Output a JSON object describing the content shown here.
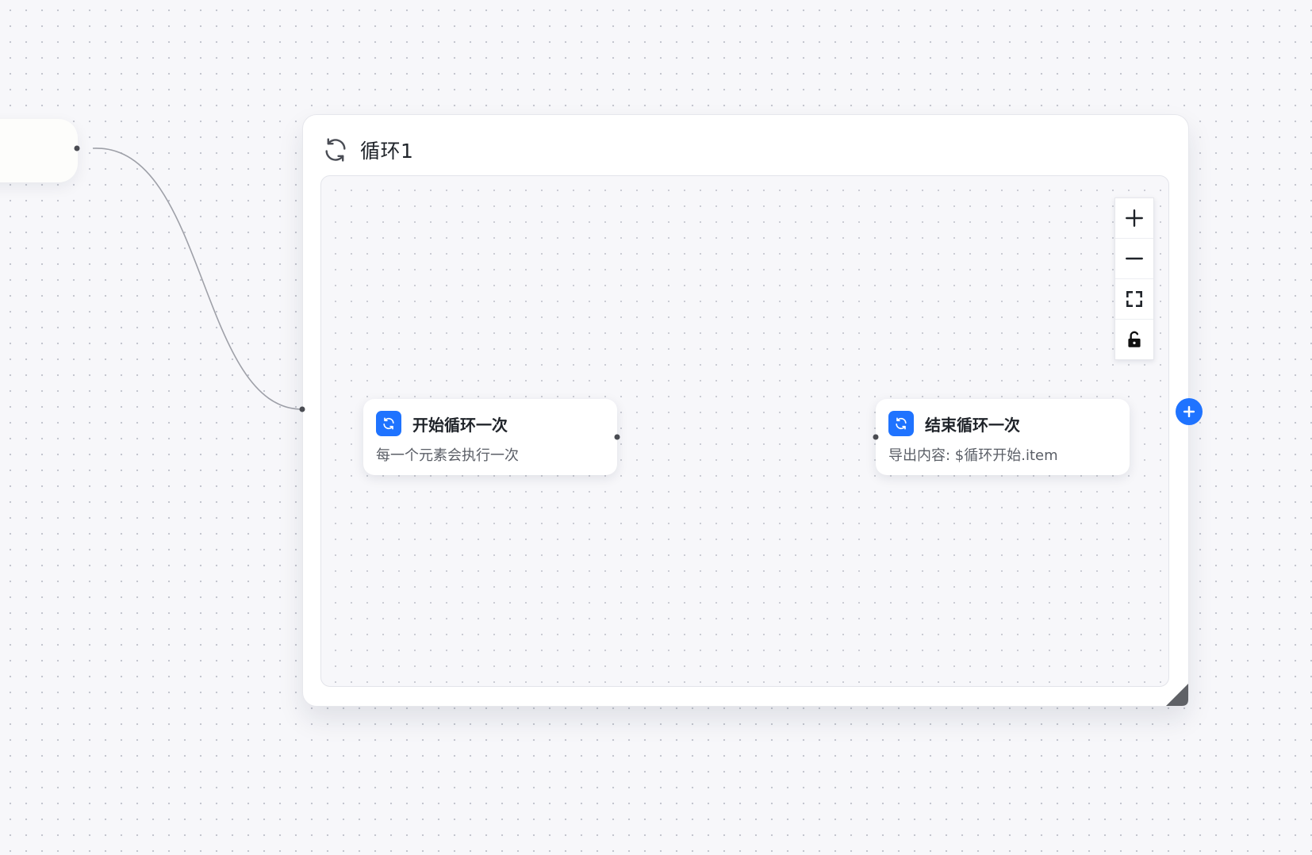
{
  "loop_group": {
    "title": "循环1",
    "icon": "refresh-icon"
  },
  "nodes": {
    "start": {
      "title": "开始循环一次",
      "description": "每一个元素会执行一次",
      "icon": "refresh-icon"
    },
    "end": {
      "title": "结束循环一次",
      "description": "导出内容: $循环开始.item",
      "icon": "refresh-icon"
    }
  },
  "controls": {
    "zoom_in_icon": "plus-icon",
    "zoom_out_icon": "minus-icon",
    "fit_view_icon": "fit-view-icon",
    "lock_icon": "unlock-icon",
    "add_node_icon": "plus-icon"
  },
  "colors": {
    "accent": "#1f73ff",
    "edge": "#9ea0a8",
    "canvas_bg": "#f7f7fa",
    "panel_bg": "#ffffff"
  }
}
